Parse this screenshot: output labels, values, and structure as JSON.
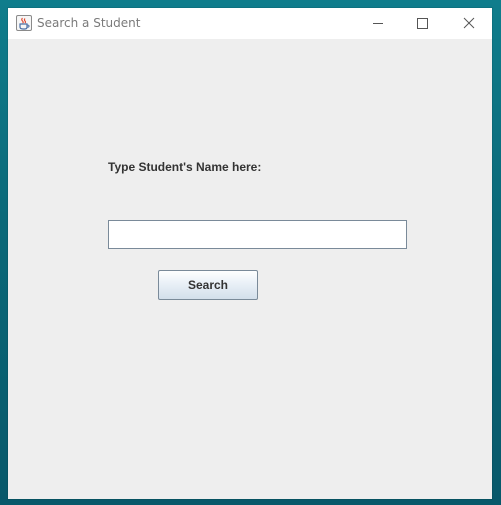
{
  "window": {
    "title": "Search a Student"
  },
  "titlebar_icons": {
    "app": "java-coffee-icon",
    "minimize": "minimize-icon",
    "maximize": "maximize-icon",
    "close": "close-icon"
  },
  "form": {
    "prompt_label": "Type Student's Name here:",
    "name_value": "",
    "search_label": "Search"
  },
  "colors": {
    "desktop": "#0a6878",
    "window_background": "#eeeeee",
    "titlebar_background": "#ffffff",
    "title_text": "#7a7a7a",
    "field_border": "#7a8a99"
  }
}
